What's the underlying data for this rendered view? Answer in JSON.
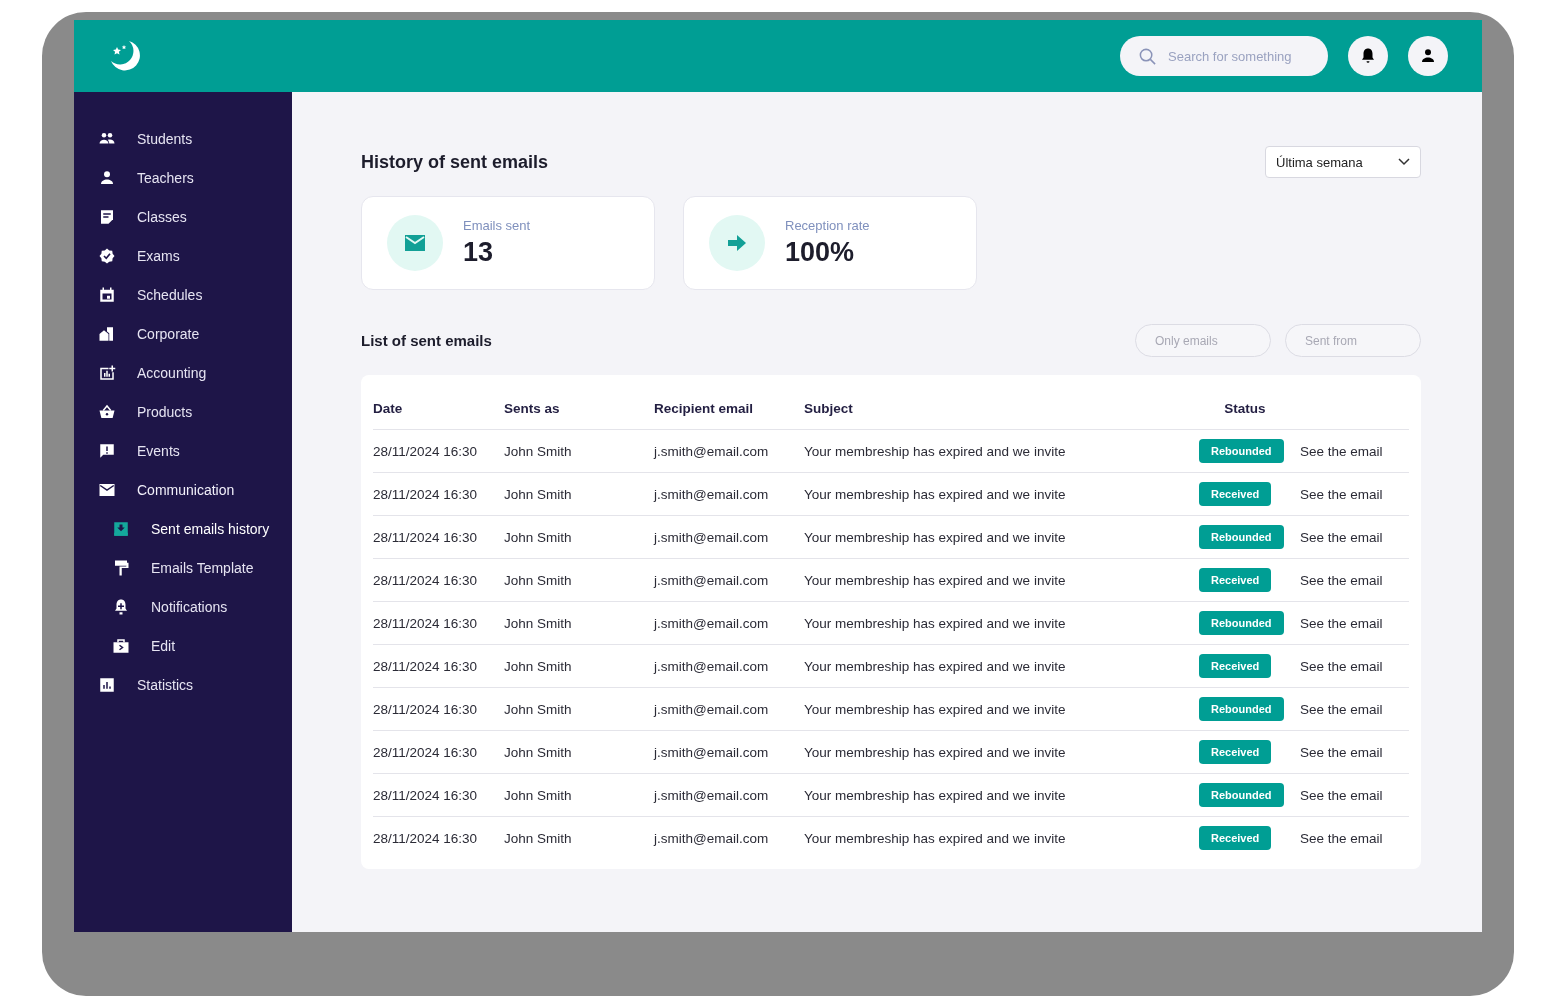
{
  "header": {
    "search": {
      "placeholder": "Search for something"
    }
  },
  "sidebar": {
    "items": [
      {
        "label": "Students",
        "selected": false
      },
      {
        "label": "Teachers",
        "selected": false
      },
      {
        "label": "Classes",
        "selected": false
      },
      {
        "label": "Exams",
        "selected": false
      },
      {
        "label": "Schedules",
        "selected": false
      },
      {
        "label": "Corporate",
        "selected": false
      },
      {
        "label": "Accounting",
        "selected": false
      },
      {
        "label": "Products",
        "selected": false
      },
      {
        "label": "Events",
        "selected": false
      },
      {
        "label": "Communication",
        "selected": false,
        "expanded": true,
        "children": [
          {
            "label": "Sent emails history",
            "selected": true
          },
          {
            "label": "Emails Template",
            "selected": false
          },
          {
            "label": "Notifications",
            "selected": false
          },
          {
            "label": "Edit",
            "selected": false
          }
        ]
      },
      {
        "label": "Statistics",
        "selected": false
      }
    ]
  },
  "main": {
    "title": "History of sent emails",
    "period": "Última semana",
    "stats": [
      {
        "label": "Emails sent",
        "value": "13"
      },
      {
        "label": "Reception rate",
        "value": "100%"
      }
    ],
    "list_title": "List of sent emails",
    "filters": [
      {
        "placeholder": "Only emails"
      },
      {
        "placeholder": "Sent from"
      }
    ],
    "table": {
      "columns": [
        "Date",
        "Sents as",
        "Recipient email",
        "Subject",
        "Status"
      ],
      "rows": [
        {
          "date": "28/11/2024 16:30",
          "sender": "John Smith",
          "email": "j.smith@email.com",
          "subject": "Your membreship has expired and we invite",
          "status": "Rebounded",
          "link": "See the email"
        },
        {
          "date": "28/11/2024 16:30",
          "sender": "John Smith",
          "email": "j.smith@email.com",
          "subject": "Your membreship has expired and we invite",
          "status": "Received",
          "link": "See the email"
        },
        {
          "date": "28/11/2024 16:30",
          "sender": "John Smith",
          "email": "j.smith@email.com",
          "subject": "Your membreship has expired and we invite",
          "status": "Rebounded",
          "link": "See the email"
        },
        {
          "date": "28/11/2024 16:30",
          "sender": "John Smith",
          "email": "j.smith@email.com",
          "subject": "Your membreship has expired and we invite",
          "status": "Received",
          "link": "See the email"
        },
        {
          "date": "28/11/2024 16:30",
          "sender": "John Smith",
          "email": "j.smith@email.com",
          "subject": "Your membreship has expired and we invite",
          "status": "Rebounded",
          "link": "See the email"
        },
        {
          "date": "28/11/2024 16:30",
          "sender": "John Smith",
          "email": "j.smith@email.com",
          "subject": "Your membreship has expired and we invite",
          "status": "Received",
          "link": "See the email"
        },
        {
          "date": "28/11/2024 16:30",
          "sender": "John Smith",
          "email": "j.smith@email.com",
          "subject": "Your membreship has expired and we invite",
          "status": "Rebounded",
          "link": "See the email"
        },
        {
          "date": "28/11/2024 16:30",
          "sender": "John Smith",
          "email": "j.smith@email.com",
          "subject": "Your membreship has expired and we invite",
          "status": "Received",
          "link": "See the email"
        },
        {
          "date": "28/11/2024 16:30",
          "sender": "John Smith",
          "email": "j.smith@email.com",
          "subject": "Your membreship has expired and we invite",
          "status": "Rebounded",
          "link": "See the email"
        },
        {
          "date": "28/11/2024 16:30",
          "sender": "John Smith",
          "email": "j.smith@email.com",
          "subject": "Your membreship has expired and we invite",
          "status": "Received",
          "link": "See the email"
        }
      ]
    }
  }
}
